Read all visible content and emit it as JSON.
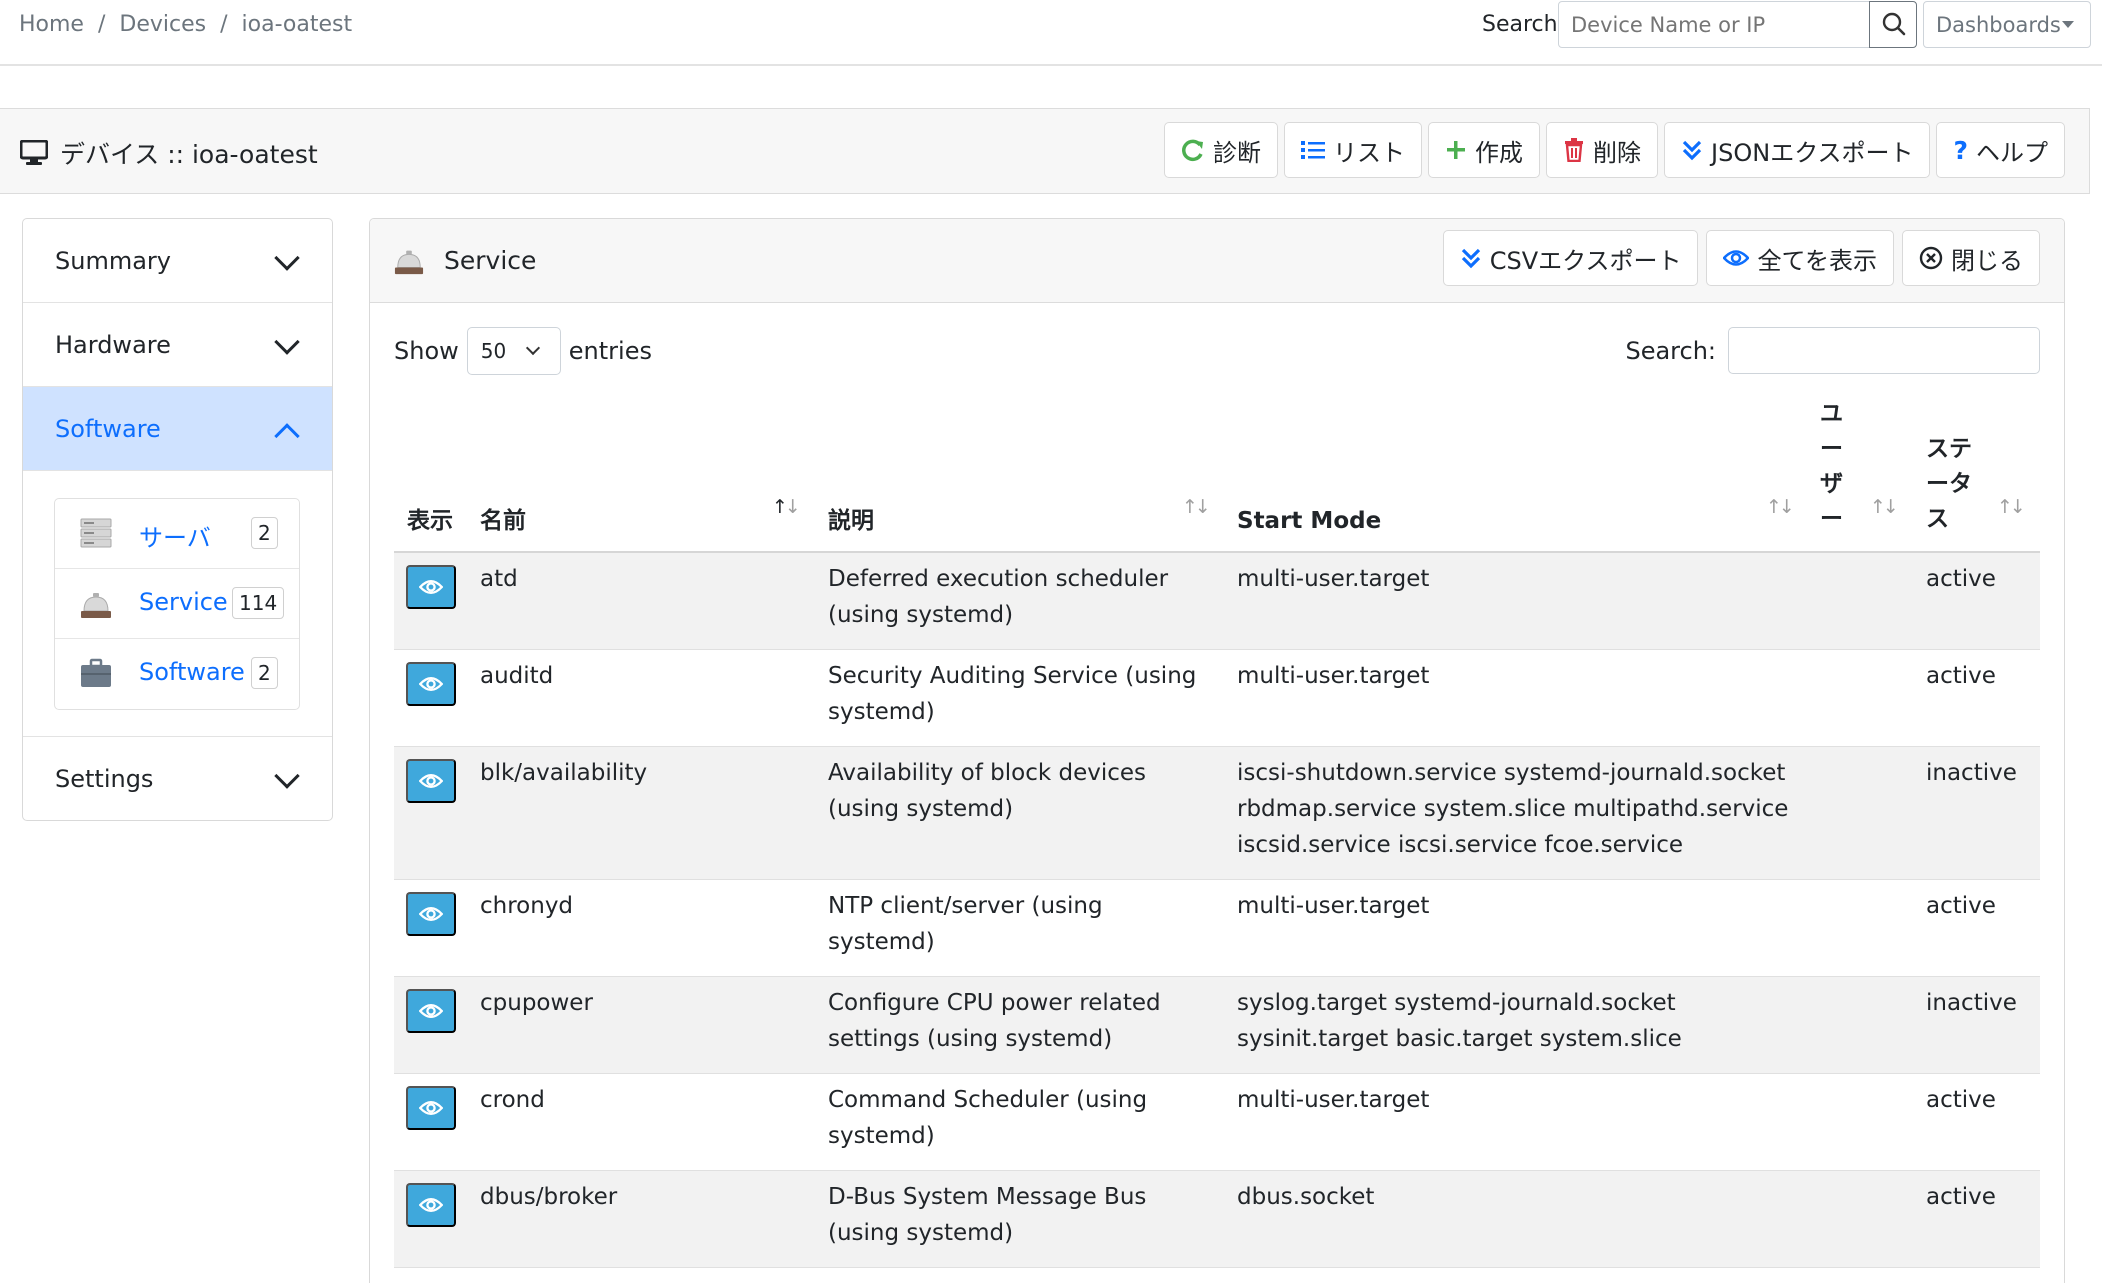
{
  "breadcrumb": [
    "Home",
    "Devices",
    "ioa-oatest"
  ],
  "topbar": {
    "search_label": "Search",
    "search_placeholder": "Device Name or IP",
    "dashboards_label": "Dashboards"
  },
  "device": {
    "title": "デバイス :: ioa-oatest",
    "buttons": [
      "診断",
      "リスト",
      "作成",
      "削除",
      "JSONエクスポート",
      "ヘルプ"
    ]
  },
  "sidebar": {
    "sections": [
      "Summary",
      "Hardware",
      "Software",
      "Settings"
    ],
    "active": "Software",
    "sub_items": [
      {
        "label": "サーバ",
        "count": "2"
      },
      {
        "label": "Service",
        "count": "114"
      },
      {
        "label": "Software",
        "count": "2"
      }
    ]
  },
  "service": {
    "title": "Service",
    "buttons": [
      "CSVエクスポート",
      "全てを表示",
      "閉じる"
    ],
    "show_label": "Show",
    "entries_value": "50",
    "entries_label": "entries",
    "search_label": "Search:",
    "columns": [
      "表示",
      "名前",
      "説明",
      "Start Mode",
      "ユーザー",
      "ステータス"
    ],
    "rows": [
      {
        "name": "atd",
        "desc": "Deferred execution scheduler (using systemd)",
        "start": "multi-user.target",
        "user": "",
        "status": "active"
      },
      {
        "name": "auditd",
        "desc": "Security Auditing Service (using systemd)",
        "start": "multi-user.target",
        "user": "",
        "status": "active"
      },
      {
        "name": "blk/availability",
        "desc": "Availability of block devices (using systemd)",
        "start": "iscsi-shutdown.service systemd-journald.socket rbdmap.service system.slice multipathd.service iscsid.service iscsi.service fcoe.service",
        "user": "",
        "status": "inactive"
      },
      {
        "name": "chronyd",
        "desc": "NTP client/server (using systemd)",
        "start": "multi-user.target",
        "user": "",
        "status": "active"
      },
      {
        "name": "cpupower",
        "desc": "Configure CPU power related settings (using systemd)",
        "start": "syslog.target systemd-journald.socket sysinit.target basic.target system.slice",
        "user": "",
        "status": "inactive"
      },
      {
        "name": "crond",
        "desc": "Command Scheduler (using systemd)",
        "start": "multi-user.target",
        "user": "",
        "status": "active"
      },
      {
        "name": "dbus/broker",
        "desc": "D-Bus System Message Bus (using systemd)",
        "start": "dbus.socket",
        "user": "",
        "status": "active"
      }
    ]
  },
  "colors": {
    "accent": "#0d6efd",
    "active_bg": "#cfe2ff",
    "eye_button": "#3fa8dc"
  },
  "icons": [
    "desktop-icon",
    "search-icon",
    "refresh-icon",
    "list-icon",
    "plus-icon",
    "trash-icon",
    "chevrons-down-icon",
    "question-icon",
    "bell-icon",
    "eye-icon",
    "close-circle-icon",
    "server-icon",
    "briefcase-icon"
  ]
}
